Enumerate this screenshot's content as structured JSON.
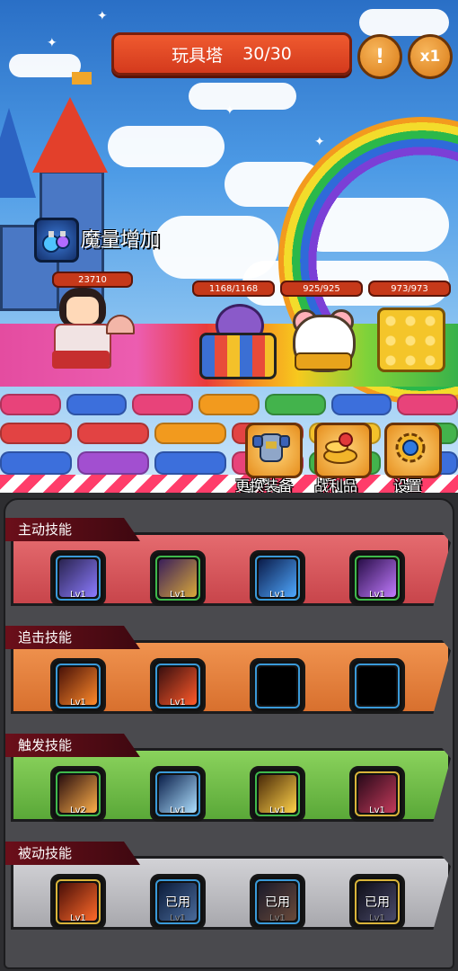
{
  "header": {
    "stage_name": "玩具塔",
    "stage_progress": "30/30",
    "info_icon": "exclamation-icon",
    "speed_label": "x1"
  },
  "buff": {
    "icon": "potion-icon",
    "label": "魔量增加"
  },
  "hero": {
    "hp": "23710"
  },
  "enemies": [
    {
      "name": "toy-octopus",
      "hp": "1168/1168"
    },
    {
      "name": "windup-mouse",
      "hp": "925/925"
    },
    {
      "name": "block-cube",
      "hp": "973/973"
    }
  ],
  "actions": [
    {
      "icon": "armor-icon",
      "label": "更换装备"
    },
    {
      "icon": "coins-icon",
      "label": "战利品"
    },
    {
      "icon": "gear-icon",
      "label": "设置"
    }
  ],
  "skill_sections": [
    {
      "title": "主动技能",
      "color": "#d9545a",
      "slots": [
        {
          "icon": "lightning-skill-icon",
          "level": "Lv1",
          "frame": "#3a9ad9"
        },
        {
          "icon": "mech-armor-skill-icon",
          "level": "Lv1",
          "frame": "#3fb94c"
        },
        {
          "icon": "comet-skill-icon",
          "level": "Lv1",
          "frame": "#3a9ad9"
        },
        {
          "icon": "crystal-burst-skill-icon",
          "level": "Lv1",
          "frame": "#3fb94c"
        }
      ]
    },
    {
      "title": "追击技能",
      "color": "#e8803a",
      "slots": [
        {
          "icon": "fire-strike-skill-icon",
          "level": "Lv1",
          "frame": "#3a9ad9"
        },
        {
          "icon": "target-skill-icon",
          "level": "Lv1",
          "frame": "#3a9ad9"
        },
        {
          "icon": "empty-slot-icon",
          "level": "",
          "frame": "#3a9ad9"
        },
        {
          "icon": "empty-slot-icon",
          "level": "",
          "frame": "#3a9ad9"
        }
      ]
    },
    {
      "title": "触发技能",
      "color": "#6fbe4a",
      "slots": [
        {
          "icon": "blade-slash-skill-icon",
          "level": "Lv2",
          "frame": "#3fb94c"
        },
        {
          "icon": "ice-crystal-skill-icon",
          "level": "Lv1",
          "frame": "#3a9ad9"
        },
        {
          "icon": "golden-bell-skill-icon",
          "level": "Lv1",
          "frame": "#3fb94c"
        },
        {
          "icon": "demon-army-skill-icon",
          "level": "Lv1",
          "frame": "#d9b43a"
        }
      ]
    },
    {
      "title": "被动技能",
      "color": "#b8b8bc",
      "slots": [
        {
          "icon": "flame-burst-skill-icon",
          "level": "Lv1",
          "frame": "#d9b43a",
          "used": ""
        },
        {
          "icon": "frost-passive-skill-icon",
          "level": "Lv1",
          "frame": "#3a9ad9",
          "used": "已用"
        },
        {
          "icon": "sigil-passive-skill-icon",
          "level": "Lv1",
          "frame": "#3a9ad9",
          "used": "已用"
        },
        {
          "icon": "shadow-passive-skill-icon",
          "level": "Lv1",
          "frame": "#d9b43a",
          "used": "已用"
        }
      ]
    }
  ]
}
